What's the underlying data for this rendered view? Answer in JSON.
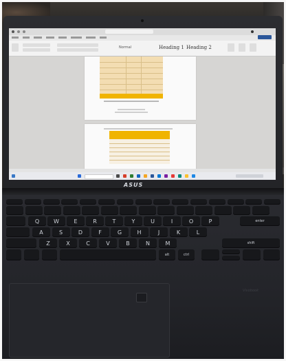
{
  "laptop": {
    "brand": "ASUS",
    "deck_brand": "Vivobook"
  },
  "screen": {
    "ribbon": {
      "style_normal": "Normal",
      "style_heading_1": "Heading 1",
      "style_heading_2": "Heading 2"
    }
  },
  "keyboard": {
    "row_letters_1": [
      "Q",
      "W",
      "E",
      "R",
      "T",
      "Y",
      "U",
      "I",
      "O",
      "P"
    ],
    "row_letters_2": [
      "A",
      "S",
      "D",
      "F",
      "G",
      "H",
      "J",
      "K",
      "L"
    ],
    "row_letters_3": [
      "Z",
      "X",
      "C",
      "V",
      "B",
      "N",
      "M"
    ],
    "enter": "enter",
    "shift": "shift",
    "ctrl": "ctrl",
    "alt": "alt"
  },
  "colors": {
    "table_header": "#f0b400",
    "table_body": "#f3ddb2",
    "share_button": "#2b579a"
  }
}
